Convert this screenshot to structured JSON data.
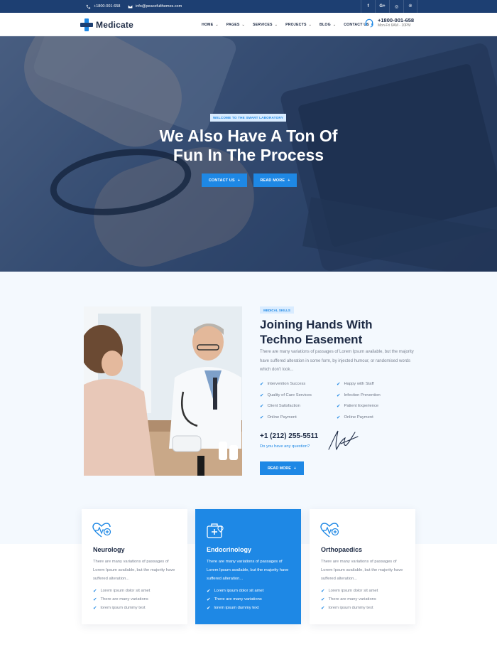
{
  "topbar": {
    "phone": "+1800-001-658",
    "email": "info@peacefulthemes.com",
    "socials": [
      {
        "icon": "facebook-icon",
        "glyph": "f"
      },
      {
        "icon": "google-plus-icon",
        "glyph": "G+"
      },
      {
        "icon": "instagram-icon",
        "glyph": "◎"
      },
      {
        "icon": "pinterest-icon",
        "glyph": "℗"
      }
    ]
  },
  "header": {
    "logo_text": "Medicate",
    "nav": [
      {
        "label": "HOME",
        "dropdown": true
      },
      {
        "label": "PAGES",
        "dropdown": true
      },
      {
        "label": "SERVICES",
        "dropdown": true
      },
      {
        "label": "PROJECTS",
        "dropdown": true
      },
      {
        "label": "BLOG",
        "dropdown": true
      },
      {
        "label": "CONTACT US",
        "dropdown": false
      }
    ],
    "phone": "+1800-001-658",
    "hours": "Mon-Fri 6AM - 10PM"
  },
  "hero": {
    "badge": "WELCOME TO THE SMART LABORATORY",
    "title_line1": "We Also Have A Ton Of",
    "title_line2": "Fun In The Process",
    "btn_contact": "CONTACT US",
    "btn_read": "READ MORE"
  },
  "about": {
    "badge": "MEDICAL SKILLS",
    "title_line1": "Joining Hands With",
    "title_line2": "Techno Easement",
    "description": "There are many variations of passages of Lorem Ipsum available, but the majority have suffered alteration in some form, by injected humour, or randomised words which don't look...",
    "checklist": [
      "Intervention Success",
      "Happy with Staff",
      "Quality of Care Services",
      "Infection Prevention",
      "Client Satisfaction",
      "Patient Experience",
      "Online Payment",
      "Online Payment"
    ],
    "phone": "+1 (212) 255-5511",
    "question": "Do you have any question?",
    "btn": "READ MORE"
  },
  "services": [
    {
      "name": "Neurology",
      "icon": "heart-rate-icon",
      "description": "There are many variations of passages of Lorem Ipsum available, but the majority have suffered alteration...",
      "items": [
        "Lorem ipsum dolor sit amet",
        "There are many variations",
        "lorem ipsum dummy text"
      ]
    },
    {
      "name": "Endocrinology",
      "icon": "medical-kit-icon",
      "description": "There are many variations of passages of Lorem Ipsum available, but the majority have suffered alteration...",
      "items": [
        "Lorem ipsum dolor sit amet",
        "There are many variations",
        "lorem ipsum dummy text"
      ]
    },
    {
      "name": "Orthopaedics",
      "icon": "heart-rate-icon",
      "description": "There are many variations of passages of Lorem Ipsum available, but the majority have suffered alteration...",
      "items": [
        "Lorem ipsum dolor sit amet",
        "There are many variations",
        "lorem ipsum dummy text"
      ]
    }
  ],
  "colors": {
    "primary": "#1e88e5",
    "navy": "#1d3f72",
    "text_dark": "#1d2a44",
    "muted": "#7a8291",
    "section_bg": "#f4f9fe"
  }
}
